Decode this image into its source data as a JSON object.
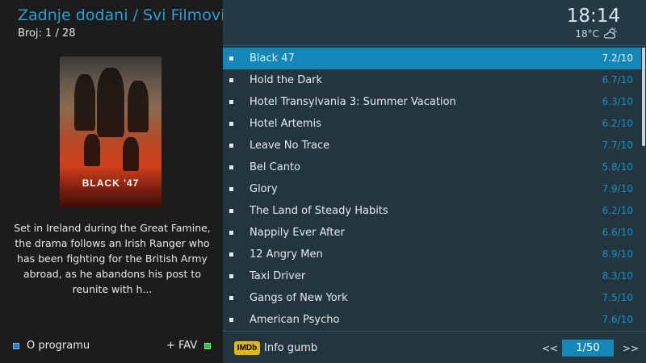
{
  "header": {
    "title": "Zadnje dodani / Svi Filmovi",
    "count": "Broj: 1 / 28"
  },
  "selected": {
    "poster_title": "BLACK '47",
    "plot": "Set in Ireland during the Great Famine, the drama follows an Irish Ranger who has been fighting for the British Army abroad, as he abandons his post to reunite with h..."
  },
  "status": {
    "time": "18:14",
    "temperature": "18°C",
    "weather_icon": "partly-cloudy-icon"
  },
  "movies": [
    {
      "title": "Black 47",
      "rating": "7.2/10",
      "selected": true
    },
    {
      "title": "Hold the Dark",
      "rating": "6.7/10"
    },
    {
      "title": "Hotel Transylvania 3: Summer Vacation",
      "rating": "6.3/10"
    },
    {
      "title": "Hotel Artemis",
      "rating": "6.2/10"
    },
    {
      "title": "Leave No Trace",
      "rating": "7.7/10"
    },
    {
      "title": "Bel Canto",
      "rating": "5.8/10"
    },
    {
      "title": "Glory",
      "rating": "7.9/10"
    },
    {
      "title": "The Land of Steady Habits",
      "rating": "6.2/10"
    },
    {
      "title": "Nappily Ever After",
      "rating": "6.6/10"
    },
    {
      "title": "12 Angry Men",
      "rating": "8.9/10"
    },
    {
      "title": "Taxi Driver",
      "rating": "8.3/10"
    },
    {
      "title": "Gangs of New York",
      "rating": "7.5/10"
    },
    {
      "title": "American Psycho",
      "rating": "7.6/10"
    }
  ],
  "footer": {
    "about_label": "O programu",
    "fav_label": "+ FAV",
    "imdb_badge": "IMDb",
    "info_label": "Info gumb",
    "prev_label": "<<",
    "page": "1/50",
    "next_label": ">>"
  },
  "colors": {
    "accent": "#1287b8",
    "title": "#2a9fd6",
    "blue_button": "#2a7ac6",
    "green_button": "#2ec43f",
    "imdb": "#e2b616"
  }
}
